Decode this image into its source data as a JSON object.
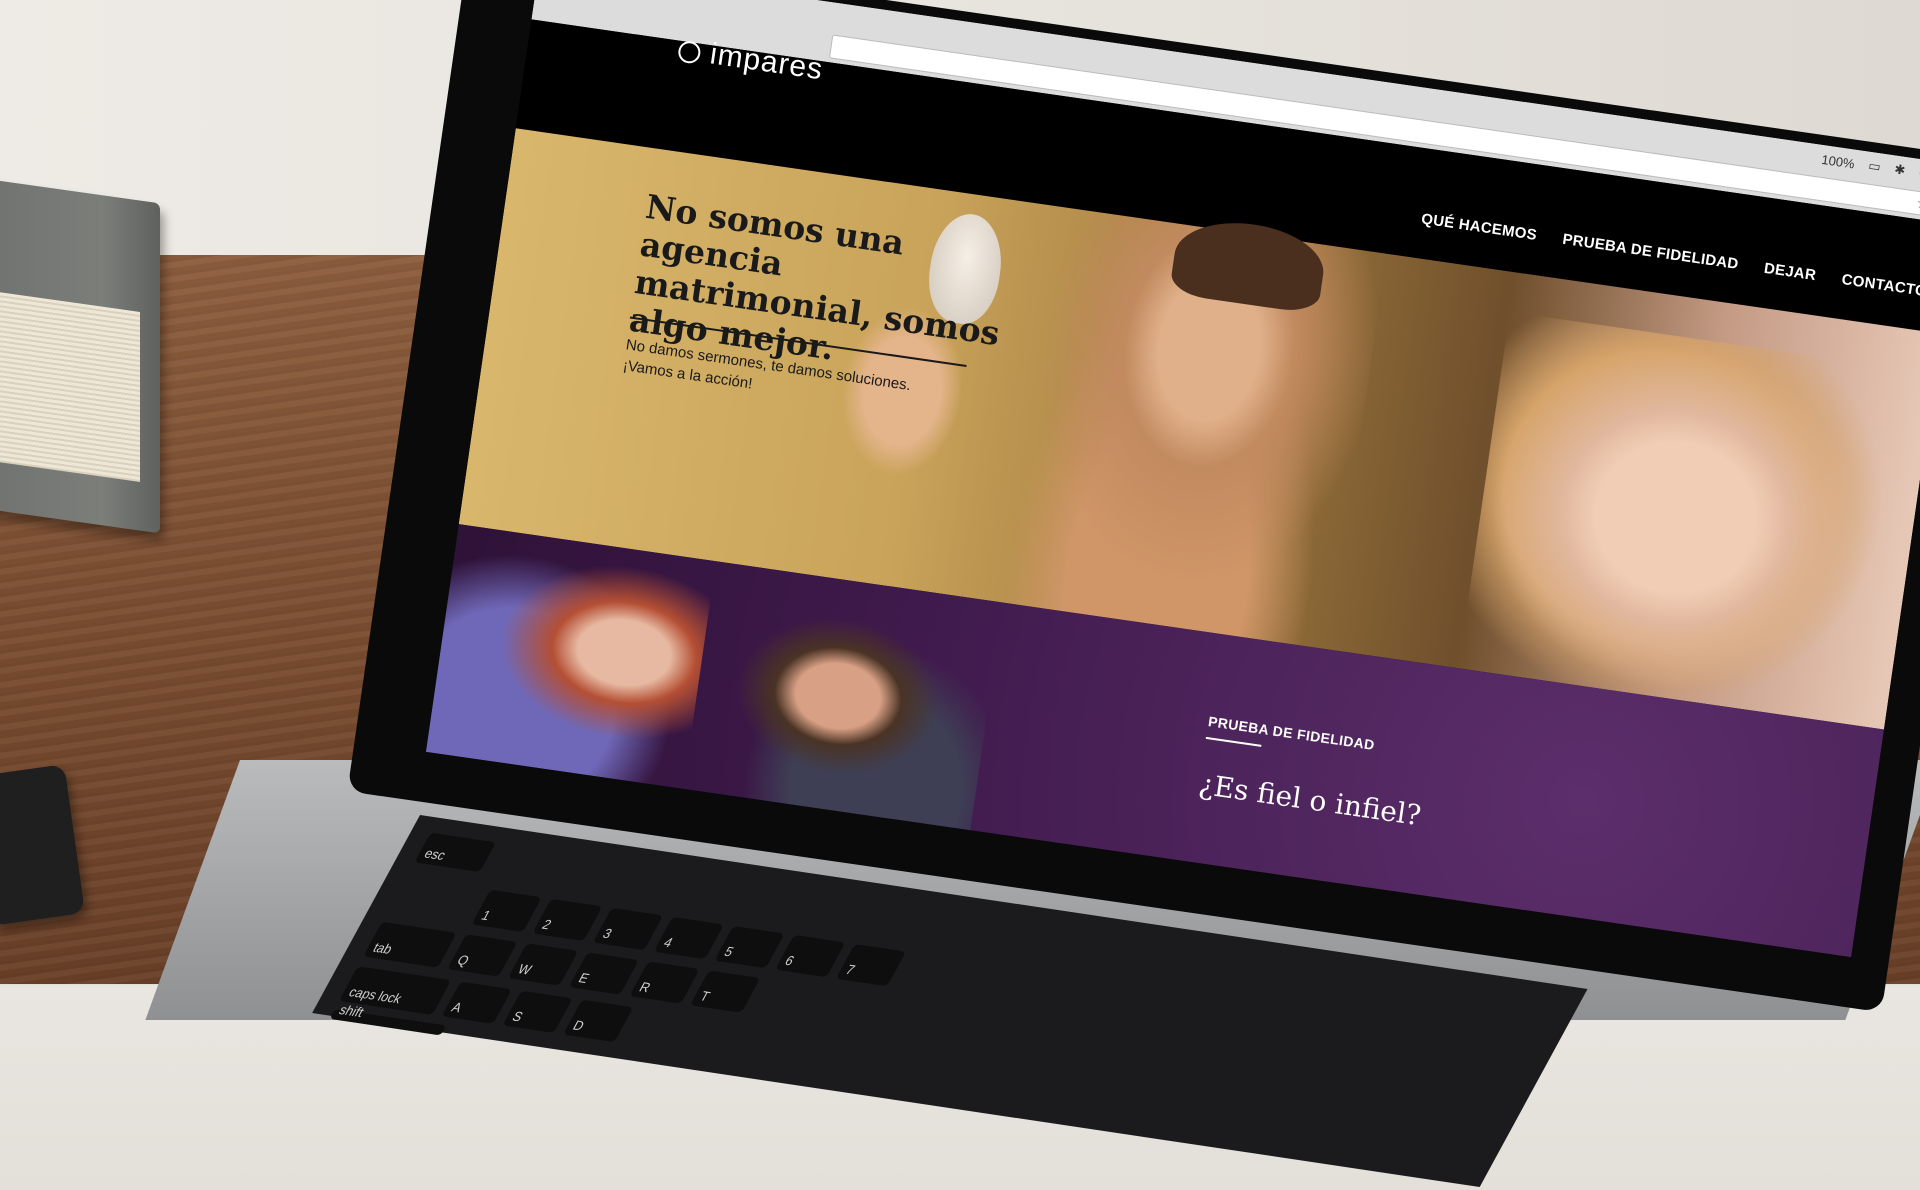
{
  "site": {
    "logo": "impares"
  },
  "browser": {
    "battery": "100%"
  },
  "nav": [
    {
      "label": "QUÉ HACEMOS"
    },
    {
      "label": "PRUEBA DE FIDELIDAD"
    },
    {
      "label": "DEJAR"
    },
    {
      "label": "CONTACTO"
    }
  ],
  "hero": {
    "title": "No somos una agencia matrimonial, somos algo mejor.",
    "subtitle": "No damos sermones, te damos soluciones. ¡Vamos a la acción!"
  },
  "section": {
    "label": "PRUEBA DE FIDELIDAD",
    "title": "¿Es fiel o infiel?"
  },
  "keyboard": {
    "keys": [
      "esc",
      "caps lock",
      "tab",
      "shift",
      "Q",
      "W",
      "E",
      "R",
      "T",
      "A",
      "S",
      "D",
      "1",
      "2",
      "3",
      "4",
      "5",
      "6",
      "7"
    ]
  }
}
